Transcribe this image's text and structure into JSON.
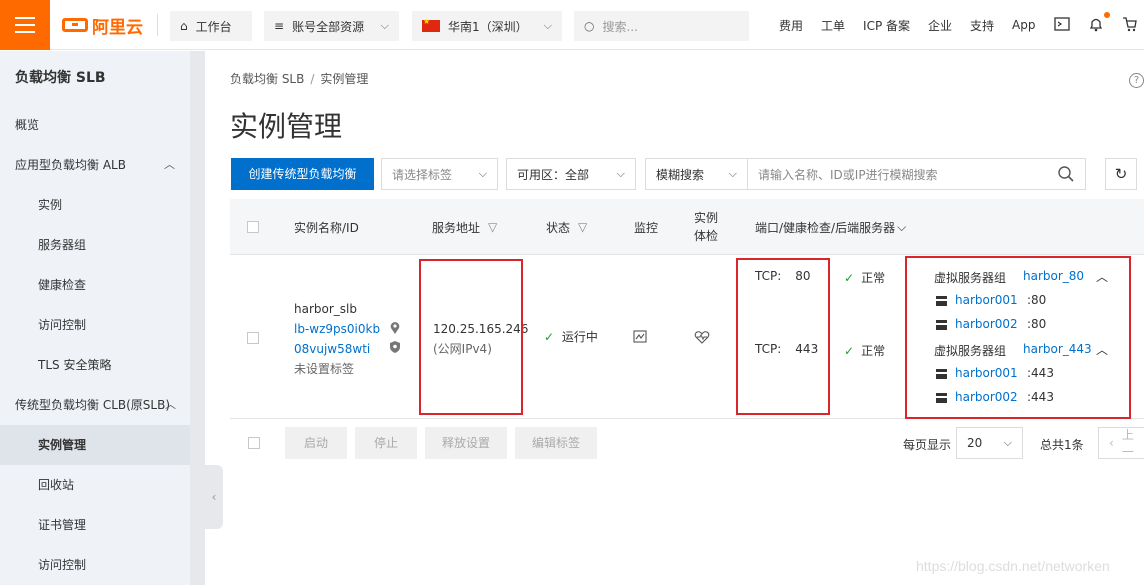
{
  "topbar": {
    "brand": "阿里云",
    "workbench": "工作台",
    "resources": "账号全部资源",
    "region": "华南1（深圳）",
    "search_placeholder": "搜索...",
    "links": [
      "费用",
      "工单",
      "ICP 备案",
      "企业",
      "支持",
      "App"
    ],
    "accent_color": "#ff6a00"
  },
  "sidebar": {
    "title": "负载均衡 SLB",
    "items": [
      {
        "label": "概览",
        "level": 1
      },
      {
        "label": "应用型负载均衡 ALB",
        "level": 1,
        "caret": "︿"
      },
      {
        "label": "实例",
        "level": 2
      },
      {
        "label": "服务器组",
        "level": 2
      },
      {
        "label": "健康检查",
        "level": 2
      },
      {
        "label": "访问控制",
        "level": 2
      },
      {
        "label": "TLS 安全策略",
        "level": 2
      },
      {
        "label": "传统型负载均衡 CLB(原SLB)",
        "level": 1,
        "caret": "︿"
      },
      {
        "label": "实例管理",
        "level": 2,
        "active": true
      },
      {
        "label": "回收站",
        "level": 2
      },
      {
        "label": "证书管理",
        "level": 2
      },
      {
        "label": "访问控制",
        "level": 2
      }
    ]
  },
  "main": {
    "breadcrumb": [
      "负载均衡 SLB",
      "实例管理"
    ],
    "title": "实例管理",
    "create_button": "创建传统型负载均衡",
    "tag_select_placeholder": "请选择标签",
    "zone_select": "可用区：全部",
    "search_mode": "模糊搜索",
    "search_placeholder": "请输入名称、ID或IP进行模糊搜索"
  },
  "table": {
    "columns": {
      "name": "实例名称/ID",
      "address": "服务地址",
      "status": "状态",
      "monitor": "监控",
      "health_1": "实例",
      "health_2": "体检",
      "ports": "端口/健康检查/后端服务器"
    },
    "rows": [
      {
        "name": "harbor_slb",
        "id_line1": "lb-wz9ps0i0kb",
        "id_line2": "08vujw58wti",
        "tag": "未设置标签",
        "ip": "120.25.165.246",
        "ip_type": "(公网IPv4)",
        "status": "运行中",
        "listeners": [
          {
            "proto": "TCP:",
            "port": "80",
            "health": "正常",
            "group_label": "虚拟服务器组",
            "group_name": "harbor_80",
            "servers": [
              {
                "name": "harbor001",
                "port": ":80"
              },
              {
                "name": "harbor002",
                "port": ":80"
              }
            ]
          },
          {
            "proto": "TCP:",
            "port": "443",
            "health": "正常",
            "group_label": "虚拟服务器组",
            "group_name": "harbor_443",
            "servers": [
              {
                "name": "harbor001",
                "port": ":443"
              },
              {
                "name": "harbor002",
                "port": ":443"
              }
            ]
          }
        ]
      }
    ]
  },
  "footer": {
    "buttons": [
      "启动",
      "停止",
      "释放设置",
      "编辑标签"
    ],
    "page_size_label": "每页显示",
    "page_size": "20",
    "total": "总共1条",
    "prev": "上一"
  },
  "watermark": "https://blog.csdn.net/networken"
}
